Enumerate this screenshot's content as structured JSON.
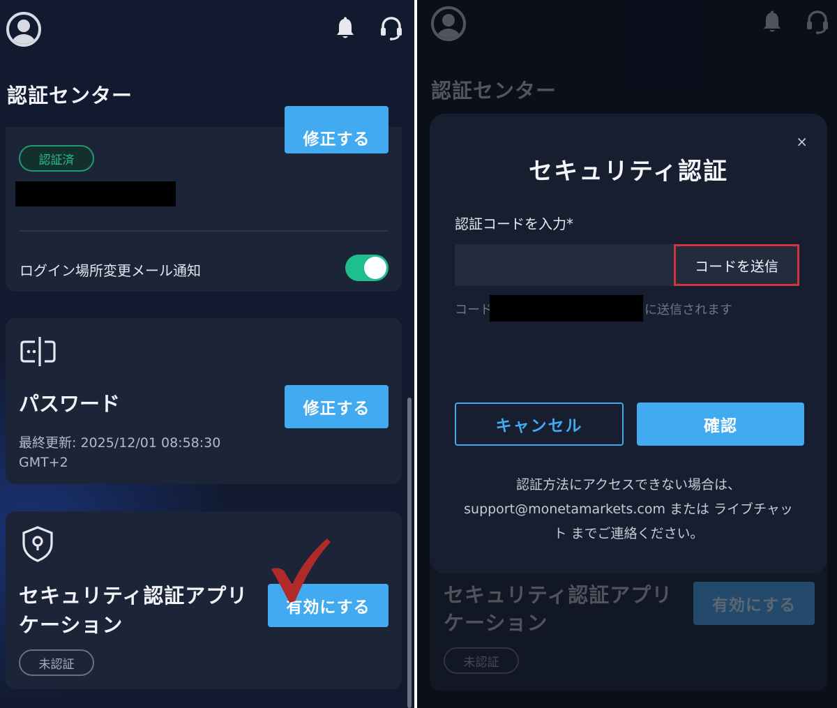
{
  "colors": {
    "accent": "#41aaf0",
    "success": "#1fbf8d",
    "highlight": "#d0343b",
    "checkmark": "#b02a2a"
  },
  "icons": {
    "avatar": "user-circle-icon",
    "notifications": "bell-icon",
    "support": "headset-icon",
    "password": "password-field-icon",
    "security": "shield-keyhole-icon",
    "annotation": "checkmark-icon",
    "close": "close-icon"
  },
  "left": {
    "title": "認証センター",
    "email_card": {
      "modify_button": "修正する",
      "status_badge": "認証済",
      "login_notification_label": "ログイン場所変更メール通知"
    },
    "password_card": {
      "title": "パスワード",
      "modify_button": "修正する",
      "last_updated": "最終更新: 2025/12/01 08:58:30",
      "timezone": "GMT+2"
    },
    "security_app_card": {
      "title_line1": "セキュリティ認証アプリ",
      "title_line2": "ケーション",
      "enable_button": "有効にする",
      "status_badge": "未認証"
    }
  },
  "right": {
    "title": "認証センター",
    "modal": {
      "title": "セキュリティ認証",
      "close_symbol": "×",
      "code_label": "認証コードを入力*",
      "send_code_button": "コードを送信",
      "hint_prefix": "コード",
      "hint_suffix": "に送信されます",
      "cancel_button": "キャンセル",
      "confirm_button": "確認",
      "help_line1": "認証方法にアクセスできない場合は、",
      "help_line2": "support@monetamarkets.com または ライブチャッ",
      "help_line3": "ト までご連絡ください。"
    },
    "background_card": {
      "title_line1": "セキュリティ認証アプリ",
      "title_line2": "ケーション",
      "enable_button": "有効にする",
      "status_badge": "未認証"
    }
  }
}
